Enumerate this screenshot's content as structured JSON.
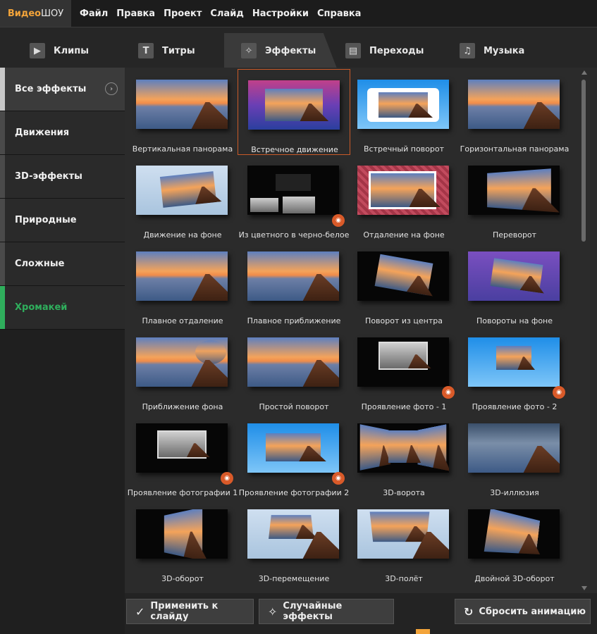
{
  "menubar": {
    "logo_part1": "Видео",
    "logo_part2": "ШОУ",
    "items": [
      "Файл",
      "Правка",
      "Проект",
      "Слайд",
      "Настройки",
      "Справка"
    ]
  },
  "tabs": [
    {
      "label": "Клипы",
      "icon": "play-icon"
    },
    {
      "label": "Титры",
      "icon": "text-t-icon"
    },
    {
      "label": "Эффекты",
      "icon": "magic-wand-icon"
    },
    {
      "label": "Переходы",
      "icon": "clapperboard-icon"
    },
    {
      "label": "Музыка",
      "icon": "music-note-icon"
    }
  ],
  "sidebar": {
    "items": [
      {
        "label": "Все эффекты"
      },
      {
        "label": "Движения"
      },
      {
        "label": "3D-эффекты"
      },
      {
        "label": "Природные"
      },
      {
        "label": "Сложные"
      },
      {
        "label": "Хромакей"
      }
    ]
  },
  "effects": [
    "Вертикальная панорама",
    "Встречное движение",
    "Встречный поворот",
    "Горизонтальная панорама",
    "Движение на фоне",
    "Из цветного в черно-белое",
    "Отдаление на фоне",
    "Переворот",
    "Плавное отдаление",
    "Плавное приближение",
    "Поворот из центра",
    "Повороты на фоне",
    "Приближение фона",
    "Простой поворот",
    "Проявление фото - 1",
    "Проявление фото - 2",
    "Проявление фотографии 1",
    "Проявление фотографии 2",
    "3D-ворота",
    "3D-иллюзия",
    "3D-оборот",
    "3D-перемещение",
    "3D-полёт",
    "Двойной 3D-оборот"
  ],
  "buttons": {
    "apply": "Применить к слайду",
    "random": "Случайные эффекты",
    "reset": "Сбросить анимацию"
  },
  "colors": {
    "accent_orange": "#d95a29",
    "chroma_green": "#2fae5c",
    "logo_orange": "#f3a43a"
  }
}
